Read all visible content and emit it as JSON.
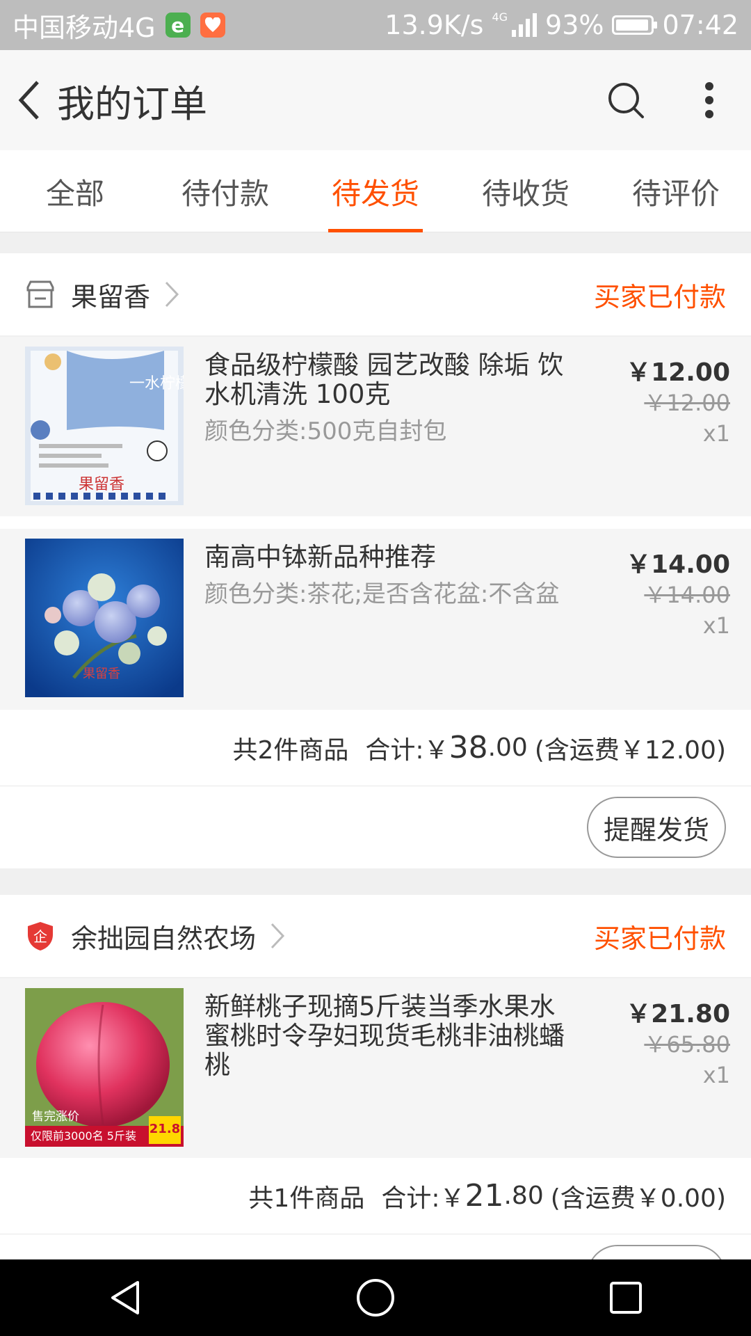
{
  "status_bar": {
    "carrier": "中国移动4G",
    "network_speed": "13.9K/s",
    "network_type": "4G",
    "battery": "93%",
    "time": "07:42"
  },
  "header": {
    "title": "我的订单"
  },
  "tabs": [
    {
      "label": "全部",
      "active": false
    },
    {
      "label": "待付款",
      "active": false
    },
    {
      "label": "待发货",
      "active": true
    },
    {
      "label": "待收货",
      "active": false
    },
    {
      "label": "待评价",
      "active": false
    }
  ],
  "orders": [
    {
      "shop_name": "果留香",
      "status": "买家已付款",
      "items": [
        {
          "title": "食品级柠檬酸 园艺改酸 除垢 饮水机清洗 100克",
          "sku": "颜色分类:500克自封包",
          "price": "￥12.00",
          "original_price": "￥12.00",
          "quantity": "x1",
          "thumb_text": "一水柠檬酸",
          "thumb_brand": "果留香"
        },
        {
          "title": "南高中钵新品种推荐",
          "sku": "颜色分类:茶花;是否含花盆:不含盆",
          "price": "￥14.00",
          "original_price": "￥14.00",
          "quantity": "x1",
          "thumb_brand": "果留香"
        }
      ],
      "summary": {
        "count": "共2件商品",
        "total_label": "合计:",
        "total_currency": "￥",
        "total_int": "38",
        "total_dec": ".00",
        "shipping": "(含运费￥12.00)"
      },
      "action": "提醒发货"
    },
    {
      "shop_name": "余拙园自然农场",
      "status": "买家已付款",
      "items": [
        {
          "title": "新鲜桃子现摘5斤装当季水果水蜜桃时令孕妇现货毛桃非油桃蟠桃",
          "price": "￥21.80",
          "original_price": "￥65.80",
          "quantity": "x1",
          "thumb_promo": "售完涨价",
          "thumb_promo2": "仅限前3000名 5斤装",
          "thumb_price": "21.8"
        }
      ],
      "summary": {
        "count": "共1件商品",
        "total_label": "合计:",
        "total_currency": "￥",
        "total_int": "21",
        "total_dec": ".80",
        "shipping": "(含运费￥0.00)"
      }
    }
  ],
  "colors": {
    "accent": "#ff5000",
    "status_bar": "#bdbdbd",
    "page_bg": "#f0f0f0"
  }
}
